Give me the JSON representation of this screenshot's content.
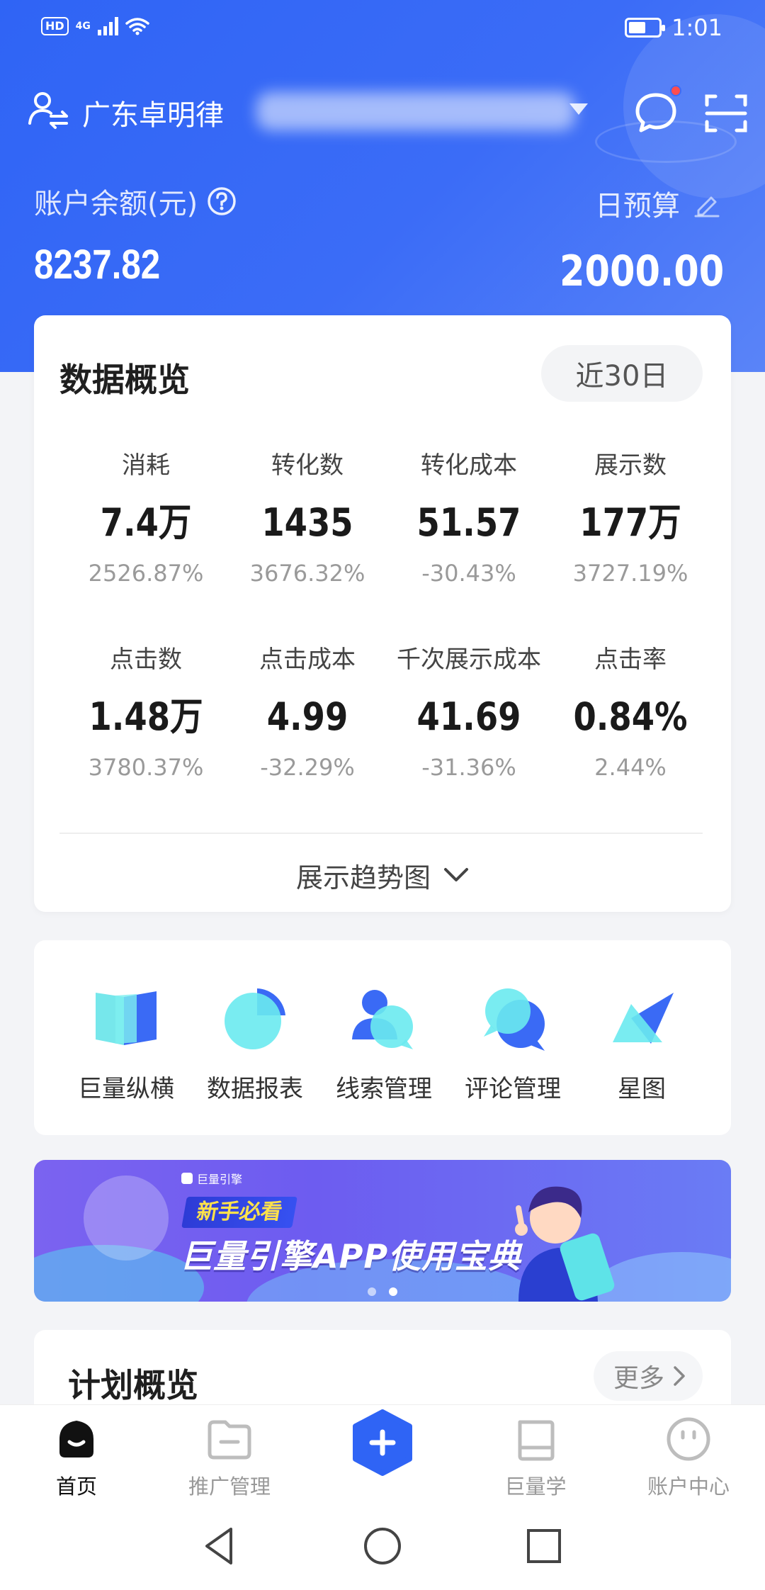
{
  "status_bar": {
    "hd": "HD",
    "network": "4G",
    "time": "1:01"
  },
  "header": {
    "account_name": "广东卓明律",
    "balance_label": "账户余额(元)",
    "balance_value": "8237.82",
    "budget_label": "日预算",
    "budget_value": "2000.00"
  },
  "overview": {
    "title": "数据概览",
    "period": "近30日",
    "metrics": [
      {
        "label": "消耗",
        "value": "7.4万",
        "change": "2526.87%"
      },
      {
        "label": "转化数",
        "value": "1435",
        "change": "3676.32%"
      },
      {
        "label": "转化成本",
        "value": "51.57",
        "change": "-30.43%"
      },
      {
        "label": "展示数",
        "value": "177万",
        "change": "3727.19%"
      },
      {
        "label": "点击数",
        "value": "1.48万",
        "change": "3780.37%"
      },
      {
        "label": "点击成本",
        "value": "4.99",
        "change": "-32.29%"
      },
      {
        "label": "千次展示成本",
        "value": "41.69",
        "change": "-31.36%"
      },
      {
        "label": "点击率",
        "value": "0.84%",
        "change": "2.44%"
      }
    ],
    "trend_toggle": "展示趋势图"
  },
  "shortcuts": [
    {
      "label": "巨量纵横",
      "icon": "map-book-icon"
    },
    {
      "label": "数据报表",
      "icon": "pie-chart-icon"
    },
    {
      "label": "线索管理",
      "icon": "user-bubble-icon"
    },
    {
      "label": "评论管理",
      "icon": "chat-bubbles-icon"
    },
    {
      "label": "星图",
      "icon": "star-map-icon"
    }
  ],
  "banner": {
    "brand": "巨量引擎",
    "tag": "新手必看",
    "title": "巨量引擎APP使用宝典",
    "page_count": 2,
    "active_page": 2
  },
  "plans": {
    "title": "计划概览",
    "more": "更多"
  },
  "tabs": [
    {
      "label": "首页",
      "active": true
    },
    {
      "label": "推广管理",
      "active": false
    },
    {
      "label": "",
      "active": false
    },
    {
      "label": "巨量学",
      "active": false
    },
    {
      "label": "账户中心",
      "active": false
    }
  ],
  "colors": {
    "brand_blue": "#2f64f5",
    "accent_cyan": "#5ee3e8",
    "notification_red": "#ff4d4f"
  }
}
